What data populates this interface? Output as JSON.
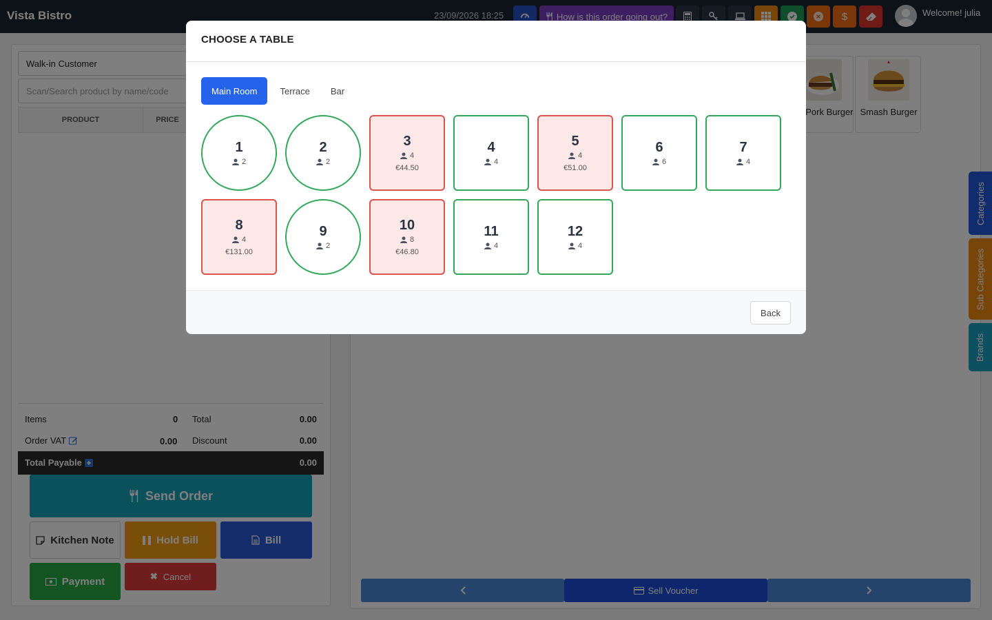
{
  "app": {
    "brand": "Vista Bistro",
    "datetime": "23/09/2026 18:25",
    "welcome": "Welcome! julia"
  },
  "topbar": {
    "order_prompt": "How is this order going out?",
    "colors": {
      "dashboard": "#2453c7",
      "order": "#7a3fc2",
      "dark": "#2d3646",
      "grid": "#f08a12",
      "green": "#1f9d55",
      "orange": "#f06d12",
      "red": "#e0352b"
    }
  },
  "left": {
    "customer": "Walk-in Customer",
    "search_placeholder": "Scan/Search product by name/code",
    "columns": [
      "PRODUCT",
      "PRICE"
    ],
    "totals": {
      "items_label": "Items",
      "items_value": "0",
      "total_label": "Total",
      "total_value": "0.00",
      "vat_label": "Order VAT",
      "vat_value": "0.00",
      "discount_label": "Discount",
      "discount_value": "0.00",
      "payable_label": "Total Payable",
      "payable_value": "0.00"
    },
    "buttons": {
      "send_order": "Send Order",
      "kitchen_note": "Kitchen Note",
      "hold_bill": "Hold Bill",
      "bill": "Bill",
      "payment": "Payment",
      "cancel": "Cancel"
    }
  },
  "right": {
    "products": [
      {
        "name": "lled Pork Burger"
      },
      {
        "name": "Smash Burger"
      }
    ],
    "sell_voucher": "Sell Voucher",
    "side_tabs": [
      "Categories",
      "Sub Categories",
      "Brands"
    ]
  },
  "modal": {
    "title": "CHOOSE A TABLE",
    "tabs": [
      "Main Room",
      "Terrace",
      "Bar"
    ],
    "active_tab": "Main Room",
    "tables": [
      {
        "number": "1",
        "seats": "2",
        "shape": "round",
        "status": "free",
        "amount": ""
      },
      {
        "number": "2",
        "seats": "2",
        "shape": "round",
        "status": "free",
        "amount": ""
      },
      {
        "number": "3",
        "seats": "4",
        "shape": "square",
        "status": "occupied",
        "amount": "€44.50"
      },
      {
        "number": "4",
        "seats": "4",
        "shape": "square",
        "status": "free",
        "amount": ""
      },
      {
        "number": "5",
        "seats": "4",
        "shape": "square",
        "status": "occupied",
        "amount": "€51.00"
      },
      {
        "number": "6",
        "seats": "6",
        "shape": "square",
        "status": "free",
        "amount": ""
      },
      {
        "number": "7",
        "seats": "4",
        "shape": "square",
        "status": "free",
        "amount": ""
      },
      {
        "number": "8",
        "seats": "4",
        "shape": "square",
        "status": "occupied",
        "amount": "€131.00"
      },
      {
        "number": "9",
        "seats": "2",
        "shape": "round",
        "status": "free",
        "amount": ""
      },
      {
        "number": "10",
        "seats": "8",
        "shape": "square",
        "status": "occupied",
        "amount": "€46.80"
      },
      {
        "number": "11",
        "seats": "4",
        "shape": "square",
        "status": "free",
        "amount": ""
      },
      {
        "number": "12",
        "seats": "4",
        "shape": "square",
        "status": "free",
        "amount": ""
      }
    ],
    "back": "Back"
  }
}
